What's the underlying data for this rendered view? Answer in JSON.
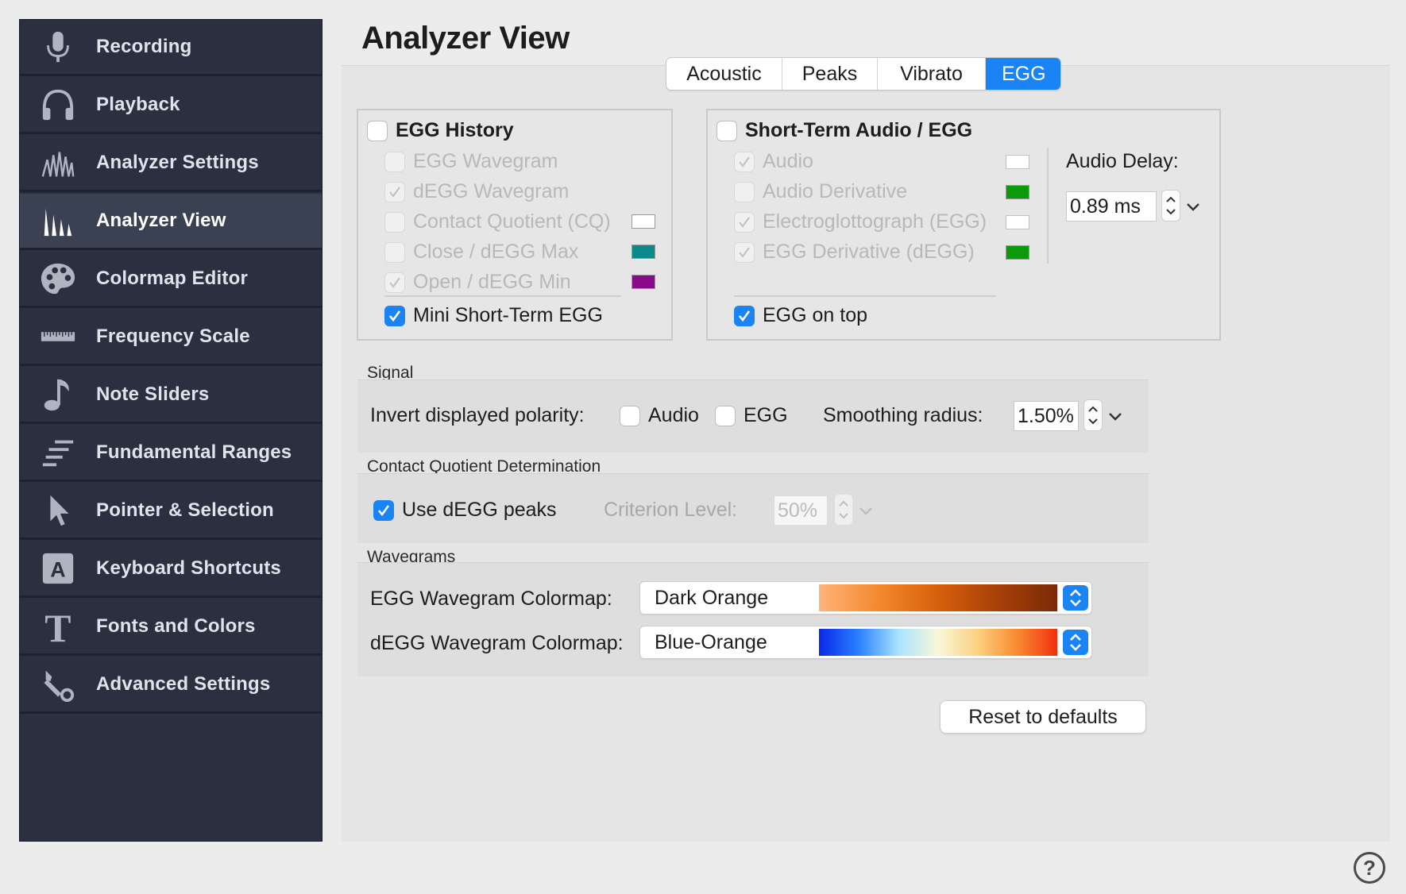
{
  "sidebar": {
    "items": [
      {
        "label": "Recording",
        "icon": "microphone-icon"
      },
      {
        "label": "Playback",
        "icon": "headphones-icon"
      },
      {
        "label": "Analyzer Settings",
        "icon": "analyzer-settings-icon"
      },
      {
        "label": "Analyzer View",
        "icon": "analyzer-view-icon",
        "active": true
      },
      {
        "label": "Colormap Editor",
        "icon": "palette-icon"
      },
      {
        "label": "Frequency Scale",
        "icon": "ruler-icon"
      },
      {
        "label": "Note Sliders",
        "icon": "music-note-icon"
      },
      {
        "label": "Fundamental Ranges",
        "icon": "ranges-icon"
      },
      {
        "label": "Pointer & Selection",
        "icon": "pointer-icon"
      },
      {
        "label": "Keyboard Shortcuts",
        "icon": "keyboard-key-icon"
      },
      {
        "label": "Fonts and Colors",
        "icon": "font-icon"
      },
      {
        "label": "Advanced Settings",
        "icon": "wrench-icon"
      }
    ]
  },
  "page_title": "Analyzer View",
  "tabs": [
    "Acoustic",
    "Peaks",
    "Vibrato",
    "EGG"
  ],
  "selected_tab": "EGG",
  "egg_history": {
    "title": "EGG History",
    "checked": false,
    "options": [
      {
        "label": "EGG Wavegram",
        "checked": false,
        "enabled": false
      },
      {
        "label": "dEGG Wavegram",
        "checked": true,
        "enabled": false
      },
      {
        "label": "Contact Quotient (CQ)",
        "checked": false,
        "enabled": false,
        "color": "#ffffff"
      },
      {
        "label": "Close / dEGG Max",
        "checked": false,
        "enabled": false,
        "color": "#0a8a8a"
      },
      {
        "label": "Open / dEGG Min",
        "checked": true,
        "enabled": false,
        "color": "#8a0a8a"
      }
    ],
    "mini_label": "Mini Short-Term EGG",
    "mini_checked": true
  },
  "short_term": {
    "title": "Short-Term Audio / EGG",
    "checked": false,
    "options": [
      {
        "label": "Audio",
        "checked": true,
        "enabled": false,
        "color": "#ffffff"
      },
      {
        "label": "Audio Derivative",
        "checked": false,
        "enabled": false,
        "color": "#0a9a0a"
      },
      {
        "label": "Electroglottograph (EGG)",
        "checked": true,
        "enabled": false,
        "color": "#ffffff"
      },
      {
        "label": "EGG Derivative (dEGG)",
        "checked": true,
        "enabled": false,
        "color": "#0a9a0a"
      }
    ],
    "egg_on_top_label": "EGG on top",
    "egg_on_top_checked": true,
    "audio_delay_label": "Audio Delay:",
    "audio_delay_value": "0.89 ms"
  },
  "signal": {
    "section_label": "Signal",
    "invert_label": "Invert displayed polarity:",
    "audio_label": "Audio",
    "egg_label": "EGG",
    "smoothing_label": "Smoothing radius:",
    "smoothing_value": "1.50%"
  },
  "cq": {
    "section_label": "Contact Quotient Determination",
    "use_degg_label": "Use dEGG peaks",
    "use_degg_checked": true,
    "criterion_label": "Criterion Level:",
    "criterion_value": "50%"
  },
  "wavegrams": {
    "section_label": "Wavegrams",
    "egg_label": "EGG Wavegram Colormap:",
    "egg_value": "Dark Orange",
    "degg_label": "dEGG Wavegram Colormap:",
    "degg_value": "Blue-Orange"
  },
  "reset_label": "Reset to defaults",
  "help_label": "?",
  "colors": {
    "accent": "#1a84f5",
    "sidebar_bg": "#2a3040",
    "sidebar_active": "#3a4152"
  }
}
